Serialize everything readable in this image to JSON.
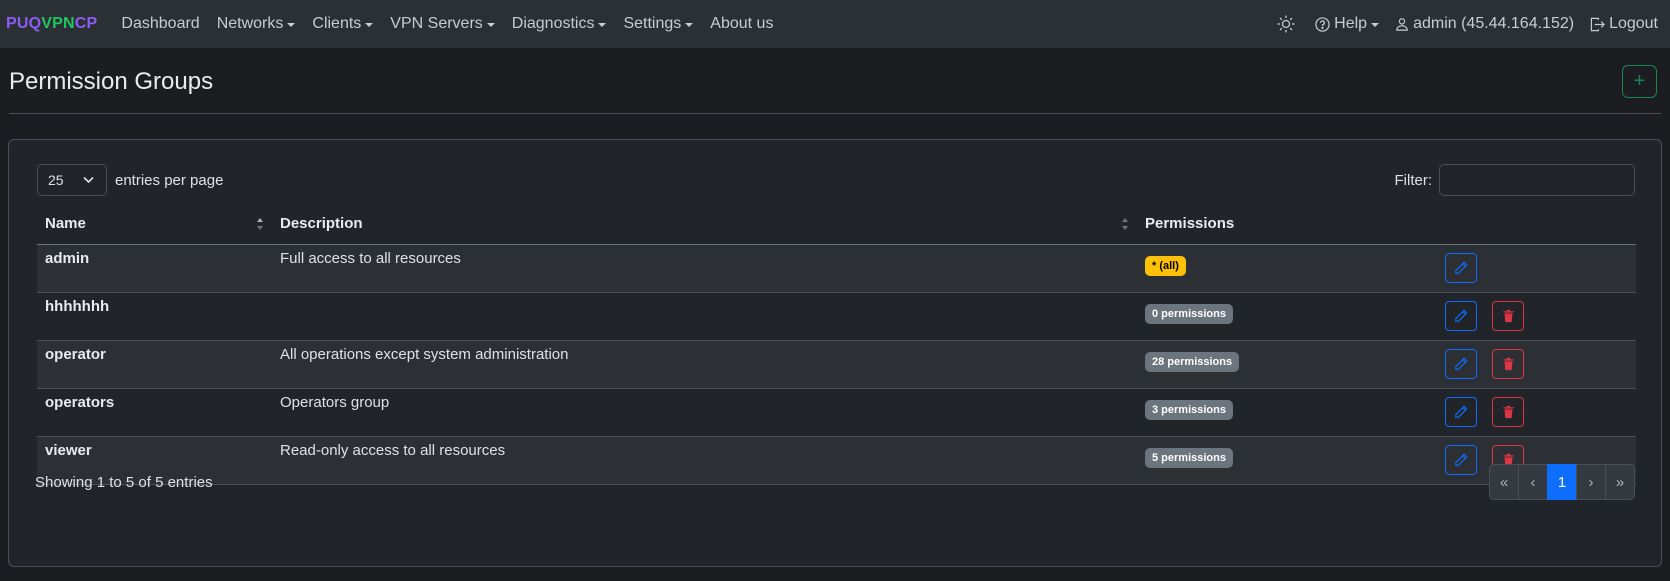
{
  "brand": {
    "part1": "PUQ",
    "part2": "VPN",
    "part3": "CP",
    "colors": [
      "#8c5cf6",
      "#22c55e",
      "#8c5cf6"
    ]
  },
  "nav": {
    "items": [
      {
        "label": "Dashboard",
        "dropdown": false
      },
      {
        "label": "Networks",
        "dropdown": true
      },
      {
        "label": "Clients",
        "dropdown": true
      },
      {
        "label": "VPN Servers",
        "dropdown": true
      },
      {
        "label": "Diagnostics",
        "dropdown": true
      },
      {
        "label": "Settings",
        "dropdown": true
      },
      {
        "label": "About us",
        "dropdown": false
      }
    ],
    "theme_icon": "sun-icon",
    "help": "Help",
    "user": "admin (45.44.164.152)",
    "logout": "Logout"
  },
  "page": {
    "title": "Permission Groups",
    "add_icon": "+"
  },
  "table_controls": {
    "page_size": "25",
    "entries_label": "entries per page",
    "filter_label": "Filter:",
    "filter_value": ""
  },
  "table": {
    "headers": [
      "Name",
      "Description",
      "Permissions"
    ],
    "rows": [
      {
        "name": "admin",
        "description": "Full access to all resources",
        "permissions": "* (all)",
        "badge": "warning",
        "deletable": false
      },
      {
        "name": "hhhhhhh",
        "description": "",
        "permissions": "0 permissions",
        "badge": "secondary",
        "deletable": true
      },
      {
        "name": "operator",
        "description": "All operations except system administration",
        "permissions": "28 permissions",
        "badge": "secondary",
        "deletable": true
      },
      {
        "name": "operators",
        "description": "Operators group",
        "permissions": "3 permissions",
        "badge": "secondary",
        "deletable": true
      },
      {
        "name": "viewer",
        "description": "Read-only access to all resources",
        "permissions": "5 permissions",
        "badge": "secondary",
        "deletable": true
      }
    ]
  },
  "footer": {
    "info": "Showing 1 to 5 of 5 entries",
    "pages": [
      "«",
      "‹",
      "1",
      "›",
      "»"
    ],
    "active_page": "1"
  }
}
